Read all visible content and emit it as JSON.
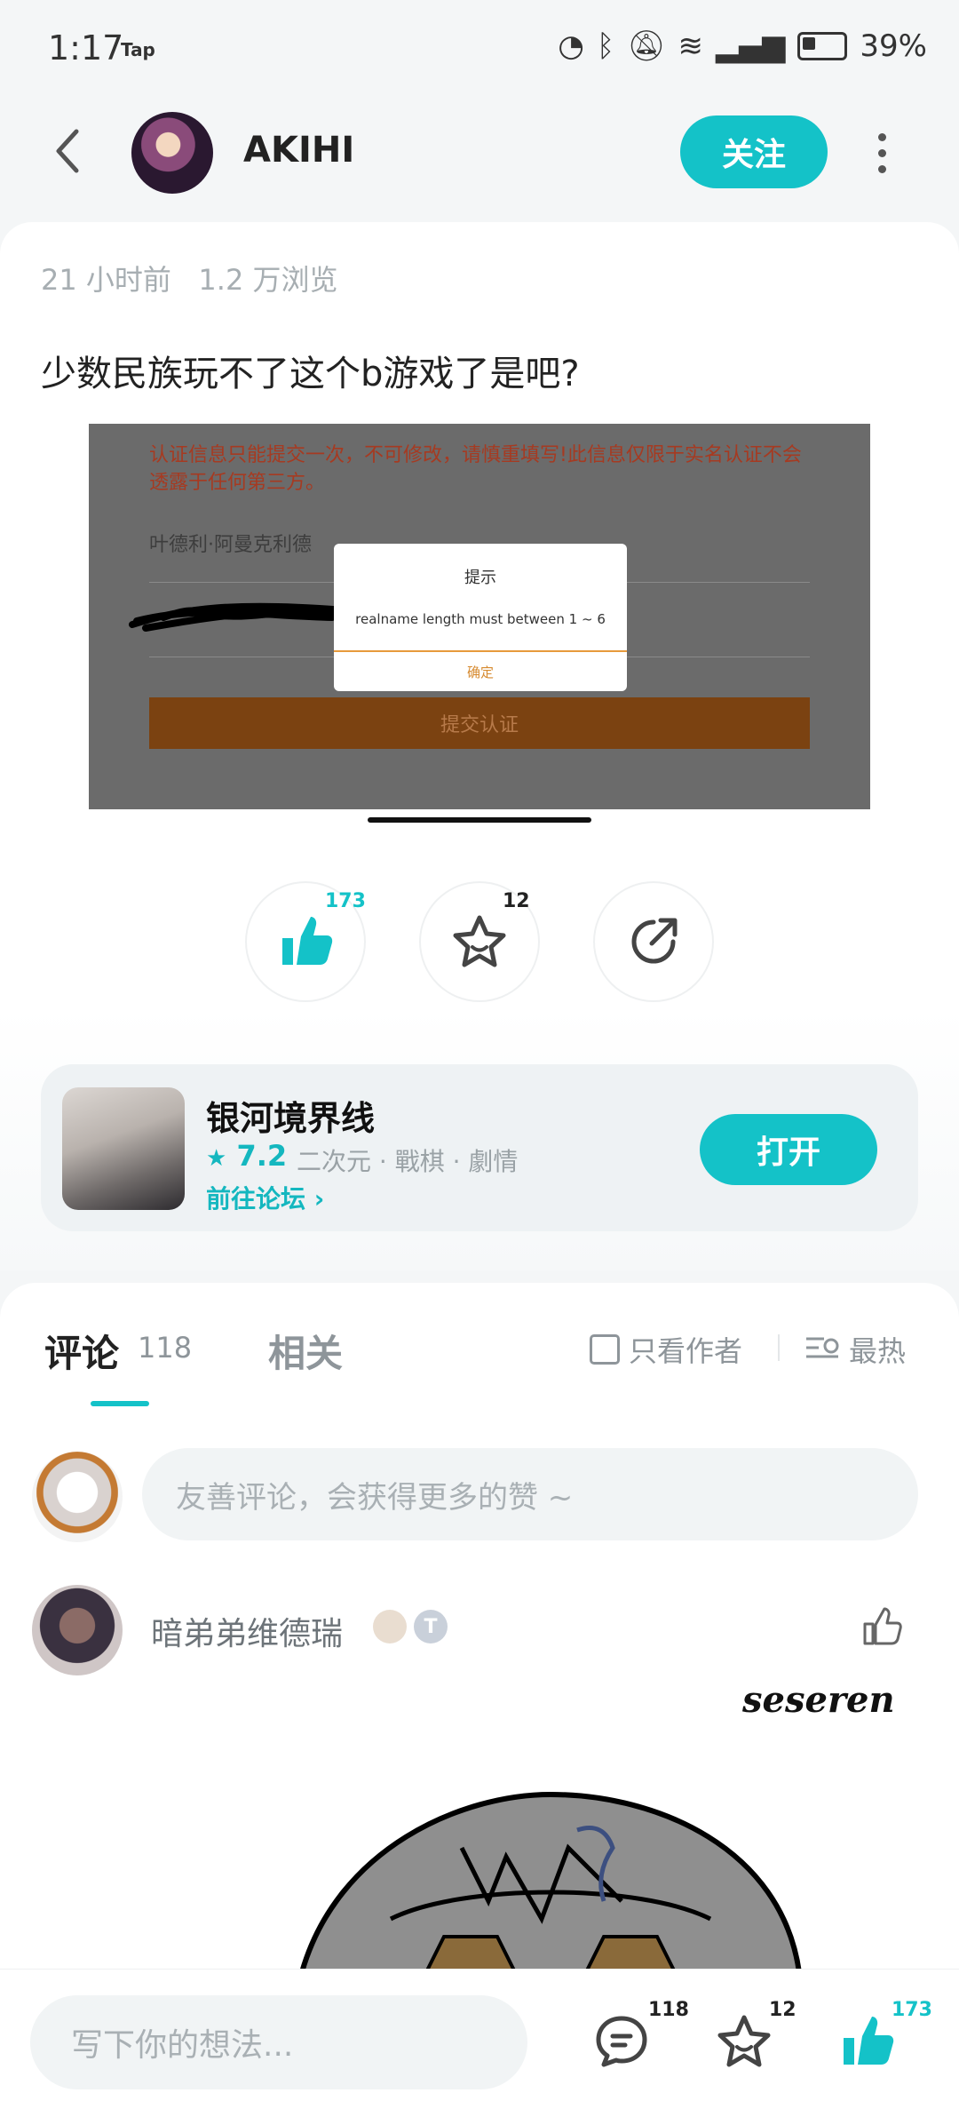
{
  "status_bar": {
    "time": "1:17",
    "tap": "Tap",
    "battery": "39%"
  },
  "header": {
    "username": "AKIHI",
    "follow_label": "关注"
  },
  "post": {
    "time_ago": "21 小时前",
    "views": "1.2 万浏览",
    "title": "少数民族玩不了这个b游戏了是吧?",
    "screenshot": {
      "warning": "认证信息只能提交一次，不可修改，请慎重填写!此信息仅限于实名认证不会透露于任何第三方。",
      "name_value": "叶德利·阿曼克利德",
      "submit_label": "提交认证",
      "dialog_title": "提示",
      "dialog_message": "realname length must between 1 ~ 6",
      "dialog_ok": "确定"
    },
    "likes": "173",
    "favorites": "12"
  },
  "game": {
    "name": "银河境界线",
    "score": "7.2",
    "tags": "二次元 · 戰棋 · 劇情",
    "forum_link": "前往论坛",
    "open_label": "打开"
  },
  "comments": {
    "tab_comments": "评论",
    "comment_count": "118",
    "tab_related": "相关",
    "only_author": "只看作者",
    "sort_label": "最热",
    "input_placeholder": "友善评论，会获得更多的赞 ~",
    "items": [
      {
        "username": "暗弟弟维德瑞",
        "badge_text": "T",
        "signature": "seseren"
      }
    ]
  },
  "bottom_bar": {
    "input_placeholder": "写下你的想法...",
    "comment_count": "118",
    "favorite_count": "12",
    "like_count": "173"
  },
  "colors": {
    "accent": "#14c2c8"
  }
}
